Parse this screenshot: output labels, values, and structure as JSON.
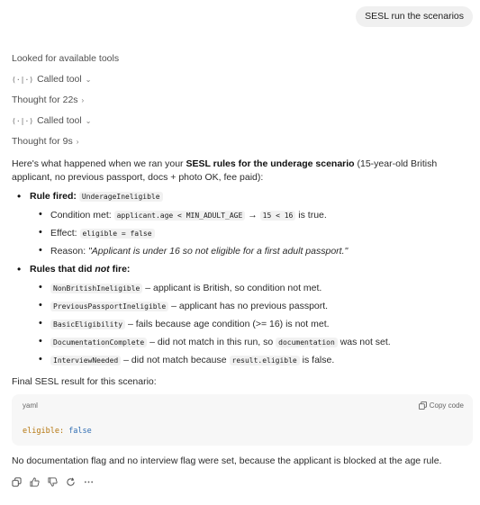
{
  "user_message": "SESL run the scenarios",
  "status_lines": [
    {
      "prefix": "",
      "text": "Looked for available tools",
      "chevron": ""
    },
    {
      "prefix": "(·|·)",
      "text": "Called tool",
      "chevron": "⌄"
    },
    {
      "prefix": "",
      "text": "Thought for 22s",
      "chevron": "›"
    },
    {
      "prefix": "(·|·)",
      "text": "Called tool",
      "chevron": "⌄"
    },
    {
      "prefix": "",
      "text": "Thought for 9s",
      "chevron": "›"
    }
  ],
  "intro": {
    "a": "Here's what happened when we ran your ",
    "b": "SESL rules for the underage scenario",
    "c": " (15-year-old British applicant, no previous passport, docs + photo OK, fee paid):"
  },
  "rules_fired": {
    "label": "Rule fired:",
    "rule": "UnderageIneligible",
    "condition_label": "Condition met:",
    "condition_code": "applicant.age < MIN_ADULT_AGE",
    "arrow": "→",
    "condition_eval": "15 < 16",
    "condition_tail": " is true.",
    "effect_label": "Effect:",
    "effect_code": "eligible = false",
    "reason_label": "Reason:",
    "reason_text": "\"Applicant is under 16 so not eligible for a first adult passport.\""
  },
  "rules_not_fired": {
    "label_a": "Rules that did ",
    "label_b": "not",
    "label_c": " fire:",
    "items": [
      {
        "code": "NonBritishIneligible",
        "text": " – applicant is British, so condition not met."
      },
      {
        "code": "PreviousPassportIneligible",
        "text": " – applicant has no previous passport."
      },
      {
        "code": "BasicEligibility",
        "text": " – fails because age condition (>= 16) is not met."
      },
      {
        "code": "DocumentationComplete",
        "text": " – did not match in this run, so ",
        "code2": "documentation",
        "text2": " was not set."
      },
      {
        "code": "InterviewNeeded",
        "text": " – did not match because ",
        "code2": "result.eligible",
        "text2": " is false."
      }
    ]
  },
  "final_label": "Final SESL result for this scenario:",
  "code_block": {
    "lang": "yaml",
    "copy_label": "Copy code",
    "key": "eligible:",
    "value": "false"
  },
  "summary": "No documentation flag and no interview flag were set, because the applicant is blocked at the age rule."
}
